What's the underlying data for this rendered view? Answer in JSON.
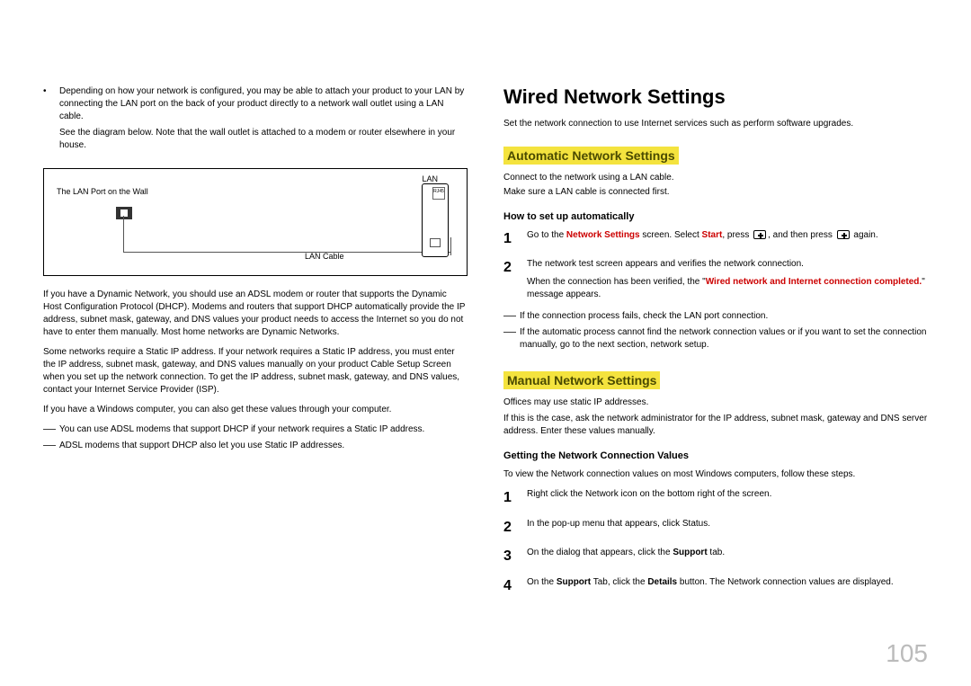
{
  "left": {
    "bullet1": "Depending on how your network is configured, you may be able to attach your product to your LAN by connecting the LAN port on the back of your product directly to a network wall outlet using a LAN cable.",
    "bullet1_note": "See the diagram below. Note that the wall outlet is attached to a modem or router elsewhere in your house.",
    "diagram": {
      "lan_port_wall": "The LAN Port on the Wall",
      "lan": "LAN",
      "rj45": "RJ45",
      "lan_cable": "LAN Cable"
    },
    "para1": "If you have a Dynamic Network, you should use an ADSL modem or router that supports the Dynamic Host Configuration Protocol (DHCP). Modems and routers that support DHCP automatically provide the IP address, subnet mask, gateway, and DNS values your product needs to access the Internet so you do not have to enter them manually. Most home networks are Dynamic Networks.",
    "para2": "Some networks require a Static IP address. If your network requires a Static IP address, you must enter the IP address, subnet mask, gateway, and DNS values manually on your product Cable Setup Screen when you set up the network connection. To get the IP address, subnet mask, gateway, and DNS values, contact your Internet Service Provider (ISP).",
    "para3": "If you have a Windows computer, you can also get these values through your computer.",
    "dash1": "You can use ADSL modems that support DHCP if your network requires a Static IP address.",
    "dash2": "ADSL modems that support DHCP also let you use Static IP addresses."
  },
  "right": {
    "h1": "Wired Network Settings",
    "intro": "Set the network connection to use Internet services such as perform software upgrades.",
    "auto": {
      "title": "Automatic Network Settings",
      "p1": "Connect to the network using a LAN cable.",
      "p2": "Make sure a LAN cable is connected first.",
      "howto": "How to set up automatically",
      "step1_a": "Go to the ",
      "step1_net": "Network Settings",
      "step1_b": " screen. Select ",
      "step1_start": "Start",
      "step1_c": ", press ",
      "step1_d": ", and then press ",
      "step1_e": " again.",
      "step2_a": "The network test screen appears and verifies the network connection.",
      "step2_b": "When the connection has been verified, the \"",
      "step2_msg": "Wired network and Internet connection completed.",
      "step2_c": "\" message appears.",
      "dash1": "If the connection process fails, check the LAN port connection.",
      "dash2": "If the automatic process cannot find the network connection values or if you want to set the connection manually, go to the next section, network setup."
    },
    "manual": {
      "title": "Manual Network Settings",
      "p1": "Offices may use static IP addresses.",
      "p2": "If this is the case, ask the network administrator for the IP address, subnet mask, gateway and DNS server address. Enter these values manually.",
      "getting": "Getting the Network Connection Values",
      "intro": "To view the Network connection values on most Windows computers, follow these steps.",
      "s1": "Right click the Network icon on the bottom right of the screen.",
      "s2": "In the pop-up menu that appears, click Status.",
      "s3_a": "On the dialog that appears, click the ",
      "s3_support": "Support",
      "s3_b": " tab.",
      "s4_a": "On the ",
      "s4_support": "Support",
      "s4_b": " Tab, click the ",
      "s4_details": "Details",
      "s4_c": " button. The Network connection values are displayed."
    }
  },
  "page": "105"
}
